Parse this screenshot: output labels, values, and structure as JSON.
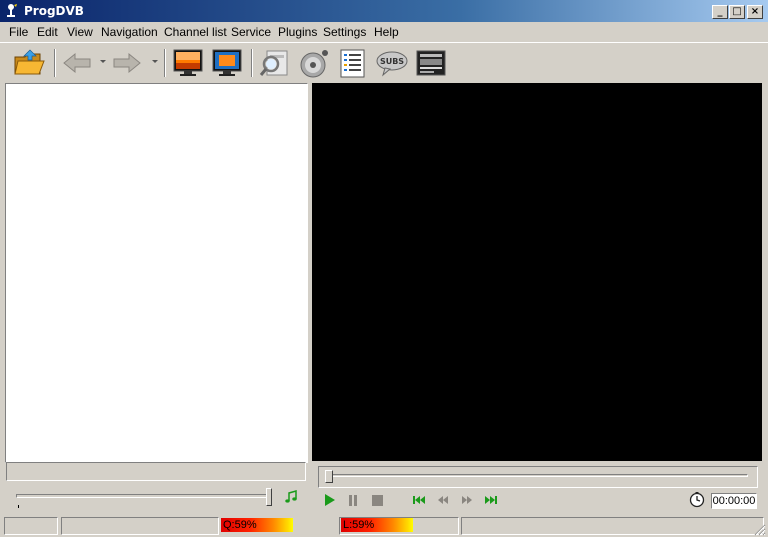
{
  "window": {
    "title": "ProgDVB"
  },
  "menu": {
    "items": [
      "File",
      "Edit",
      "View",
      "Navigation",
      "Channel list",
      "Service",
      "Plugins",
      "Settings",
      "Help"
    ]
  },
  "toolbar": {
    "buttons": [
      {
        "name": "open-folder-icon"
      },
      {
        "name": "back-arrow-icon"
      },
      {
        "name": "forward-arrow-icon"
      },
      {
        "name": "monitor-icon"
      },
      {
        "name": "monitor-blue-icon"
      },
      {
        "name": "search-channel-icon"
      },
      {
        "name": "disc-record-icon"
      },
      {
        "name": "epg-list-icon"
      },
      {
        "name": "subtitles-icon",
        "label": "SUBS"
      },
      {
        "name": "teletext-icon"
      }
    ]
  },
  "player": {
    "time": "00:00:00",
    "controls": [
      "play-icon",
      "pause-icon",
      "stop-icon",
      "skip-back-icon",
      "rewind-icon",
      "fast-forward-icon",
      "skip-forward-icon"
    ]
  },
  "volume": {
    "level": 0.98
  },
  "status": {
    "quality": "Q:59%",
    "level": "L:59%",
    "quality_percent": 59,
    "level_percent": 59
  },
  "colors": {
    "titlebar_start": "#0a246a",
    "titlebar_end": "#a6caf0",
    "play_green": "#1a9a1a",
    "window_bg": "#d4d0c8",
    "video_bg": "#000000"
  }
}
